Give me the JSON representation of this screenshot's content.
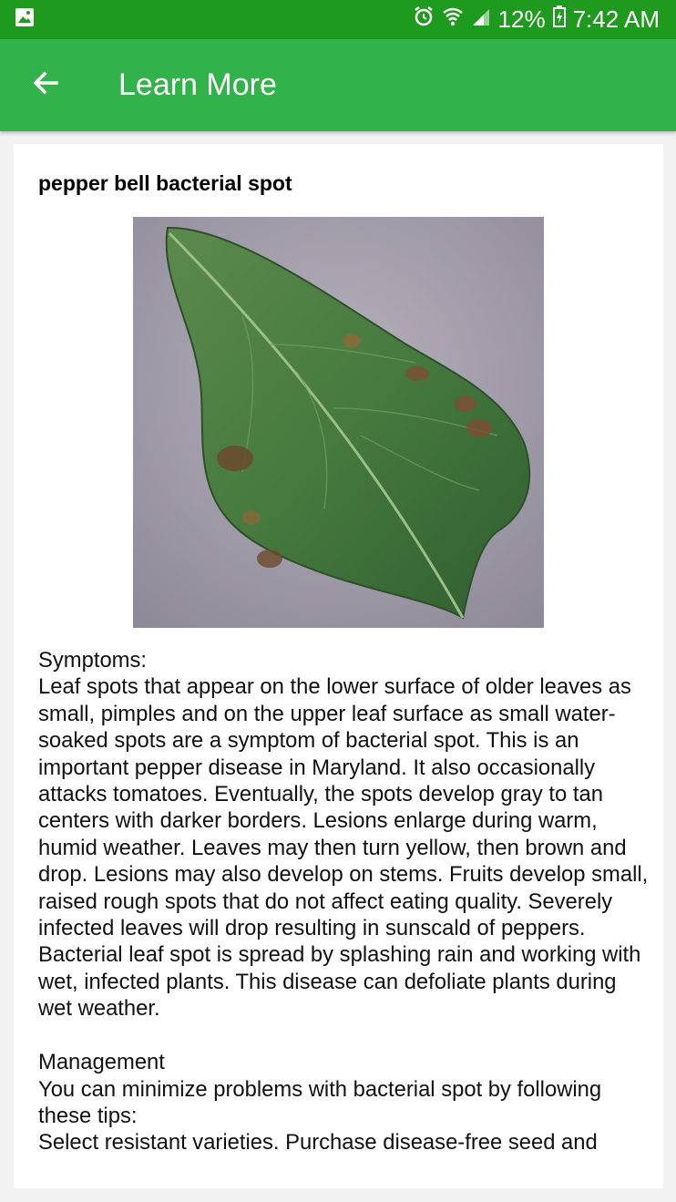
{
  "status_bar": {
    "battery": "12%",
    "time": "7:42 AM",
    "icons": [
      "image-icon",
      "alarm-icon",
      "wifi-icon",
      "signal-icon",
      "battery-charging-icon"
    ]
  },
  "app_bar": {
    "title": "Learn More",
    "back_icon": "back-arrow-icon"
  },
  "colors": {
    "status_bar": "#1e9b1e",
    "app_bar": "#32b24a",
    "background": "#f2f2f2"
  },
  "content": {
    "title": "pepper bell bacterial spot",
    "image": "leaf-photo",
    "body": "Symptoms:\nLeaf spots that appear on the lower surface of older leaves as small, pimples and on the upper leaf surface as small water-soaked spots are a symptom of bacterial spot. This is an important pepper disease in Maryland. It also occasionally attacks tomatoes. Eventually, the spots develop gray to tan centers with darker borders. Lesions enlarge during warm, humid weather. Leaves may then turn yellow, then brown and drop. Lesions may also develop on stems. Fruits develop small, raised rough spots that do not affect eating quality. Severely infected leaves will drop resulting in sunscald of peppers. Bacterial leaf spot is spread by splashing rain and working with wet, infected plants. This disease can defoliate plants during wet weather.\n\nManagement\nYou can minimize problems with bacterial spot by following these tips:\nSelect resistant varieties. Purchase disease-free seed and"
  }
}
